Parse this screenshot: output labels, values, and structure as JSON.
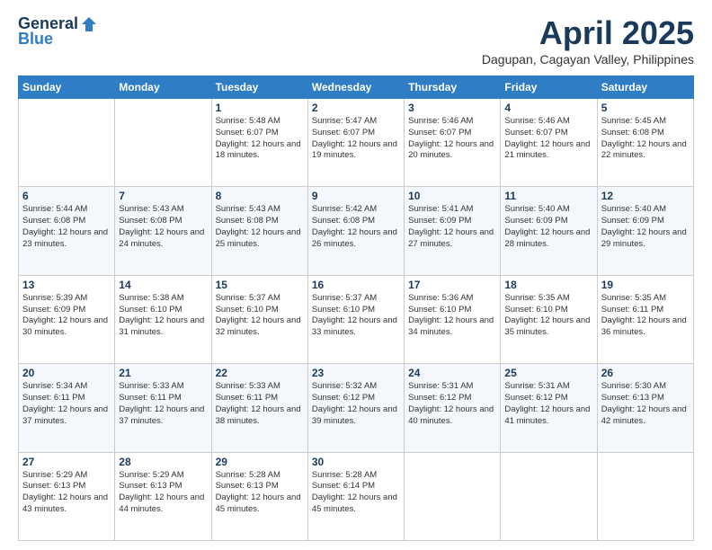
{
  "header": {
    "logo_general": "General",
    "logo_blue": "Blue",
    "month": "April 2025",
    "location": "Dagupan, Cagayan Valley, Philippines"
  },
  "days_of_week": [
    "Sunday",
    "Monday",
    "Tuesday",
    "Wednesday",
    "Thursday",
    "Friday",
    "Saturday"
  ],
  "weeks": [
    [
      {
        "day": "",
        "content": ""
      },
      {
        "day": "",
        "content": ""
      },
      {
        "day": "1",
        "content": "Sunrise: 5:48 AM\nSunset: 6:07 PM\nDaylight: 12 hours and 18 minutes."
      },
      {
        "day": "2",
        "content": "Sunrise: 5:47 AM\nSunset: 6:07 PM\nDaylight: 12 hours and 19 minutes."
      },
      {
        "day": "3",
        "content": "Sunrise: 5:46 AM\nSunset: 6:07 PM\nDaylight: 12 hours and 20 minutes."
      },
      {
        "day": "4",
        "content": "Sunrise: 5:46 AM\nSunset: 6:07 PM\nDaylight: 12 hours and 21 minutes."
      },
      {
        "day": "5",
        "content": "Sunrise: 5:45 AM\nSunset: 6:08 PM\nDaylight: 12 hours and 22 minutes."
      }
    ],
    [
      {
        "day": "6",
        "content": "Sunrise: 5:44 AM\nSunset: 6:08 PM\nDaylight: 12 hours and 23 minutes."
      },
      {
        "day": "7",
        "content": "Sunrise: 5:43 AM\nSunset: 6:08 PM\nDaylight: 12 hours and 24 minutes."
      },
      {
        "day": "8",
        "content": "Sunrise: 5:43 AM\nSunset: 6:08 PM\nDaylight: 12 hours and 25 minutes."
      },
      {
        "day": "9",
        "content": "Sunrise: 5:42 AM\nSunset: 6:08 PM\nDaylight: 12 hours and 26 minutes."
      },
      {
        "day": "10",
        "content": "Sunrise: 5:41 AM\nSunset: 6:09 PM\nDaylight: 12 hours and 27 minutes."
      },
      {
        "day": "11",
        "content": "Sunrise: 5:40 AM\nSunset: 6:09 PM\nDaylight: 12 hours and 28 minutes."
      },
      {
        "day": "12",
        "content": "Sunrise: 5:40 AM\nSunset: 6:09 PM\nDaylight: 12 hours and 29 minutes."
      }
    ],
    [
      {
        "day": "13",
        "content": "Sunrise: 5:39 AM\nSunset: 6:09 PM\nDaylight: 12 hours and 30 minutes."
      },
      {
        "day": "14",
        "content": "Sunrise: 5:38 AM\nSunset: 6:10 PM\nDaylight: 12 hours and 31 minutes."
      },
      {
        "day": "15",
        "content": "Sunrise: 5:37 AM\nSunset: 6:10 PM\nDaylight: 12 hours and 32 minutes."
      },
      {
        "day": "16",
        "content": "Sunrise: 5:37 AM\nSunset: 6:10 PM\nDaylight: 12 hours and 33 minutes."
      },
      {
        "day": "17",
        "content": "Sunrise: 5:36 AM\nSunset: 6:10 PM\nDaylight: 12 hours and 34 minutes."
      },
      {
        "day": "18",
        "content": "Sunrise: 5:35 AM\nSunset: 6:10 PM\nDaylight: 12 hours and 35 minutes."
      },
      {
        "day": "19",
        "content": "Sunrise: 5:35 AM\nSunset: 6:11 PM\nDaylight: 12 hours and 36 minutes."
      }
    ],
    [
      {
        "day": "20",
        "content": "Sunrise: 5:34 AM\nSunset: 6:11 PM\nDaylight: 12 hours and 37 minutes."
      },
      {
        "day": "21",
        "content": "Sunrise: 5:33 AM\nSunset: 6:11 PM\nDaylight: 12 hours and 37 minutes."
      },
      {
        "day": "22",
        "content": "Sunrise: 5:33 AM\nSunset: 6:11 PM\nDaylight: 12 hours and 38 minutes."
      },
      {
        "day": "23",
        "content": "Sunrise: 5:32 AM\nSunset: 6:12 PM\nDaylight: 12 hours and 39 minutes."
      },
      {
        "day": "24",
        "content": "Sunrise: 5:31 AM\nSunset: 6:12 PM\nDaylight: 12 hours and 40 minutes."
      },
      {
        "day": "25",
        "content": "Sunrise: 5:31 AM\nSunset: 6:12 PM\nDaylight: 12 hours and 41 minutes."
      },
      {
        "day": "26",
        "content": "Sunrise: 5:30 AM\nSunset: 6:13 PM\nDaylight: 12 hours and 42 minutes."
      }
    ],
    [
      {
        "day": "27",
        "content": "Sunrise: 5:29 AM\nSunset: 6:13 PM\nDaylight: 12 hours and 43 minutes."
      },
      {
        "day": "28",
        "content": "Sunrise: 5:29 AM\nSunset: 6:13 PM\nDaylight: 12 hours and 44 minutes."
      },
      {
        "day": "29",
        "content": "Sunrise: 5:28 AM\nSunset: 6:13 PM\nDaylight: 12 hours and 45 minutes."
      },
      {
        "day": "30",
        "content": "Sunrise: 5:28 AM\nSunset: 6:14 PM\nDaylight: 12 hours and 45 minutes."
      },
      {
        "day": "",
        "content": ""
      },
      {
        "day": "",
        "content": ""
      },
      {
        "day": "",
        "content": ""
      }
    ]
  ]
}
